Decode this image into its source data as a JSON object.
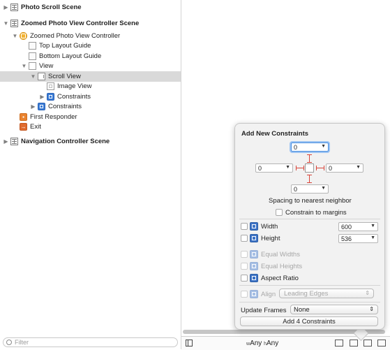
{
  "outline": {
    "items": [
      {
        "label": "Photo Scroll Scene"
      },
      {
        "label": "Zoomed Photo View Controller Scene"
      },
      {
        "label": "Zoomed Photo View Controller"
      },
      {
        "label": "Top Layout Guide"
      },
      {
        "label": "Bottom Layout Guide"
      },
      {
        "label": "View"
      },
      {
        "label": "Scroll View"
      },
      {
        "label": "Image View"
      },
      {
        "label": "Constraints"
      },
      {
        "label": "Constraints"
      },
      {
        "label": "First Responder"
      },
      {
        "label": "Exit"
      },
      {
        "label": "Navigation Controller Scene"
      }
    ],
    "filter_placeholder": "Filter"
  },
  "bottom_bar": {
    "width_prefix": "w",
    "width_value": "Any",
    "height_prefix": "h",
    "height_value": "Any"
  },
  "popover": {
    "title": "Add New Constraints",
    "top_value": "0",
    "left_value": "0",
    "right_value": "0",
    "bottom_value": "0",
    "spacing_label": "Spacing to nearest neighbor",
    "constrain_margins_label": "Constrain to margins",
    "width_label": "Width",
    "width_value": "600",
    "height_label": "Height",
    "height_value": "536",
    "equal_widths_label": "Equal Widths",
    "equal_heights_label": "Equal Heights",
    "aspect_ratio_label": "Aspect Ratio",
    "align_label": "Align",
    "align_value": "Leading Edges",
    "update_frames_label": "Update Frames",
    "update_frames_value": "None",
    "add_button_label": "Add 4 Constraints"
  },
  "colors": {
    "constraint_red": "#d9453a",
    "selection_gray": "#d9d9d9",
    "focus_blue": "#4a8fe0"
  }
}
